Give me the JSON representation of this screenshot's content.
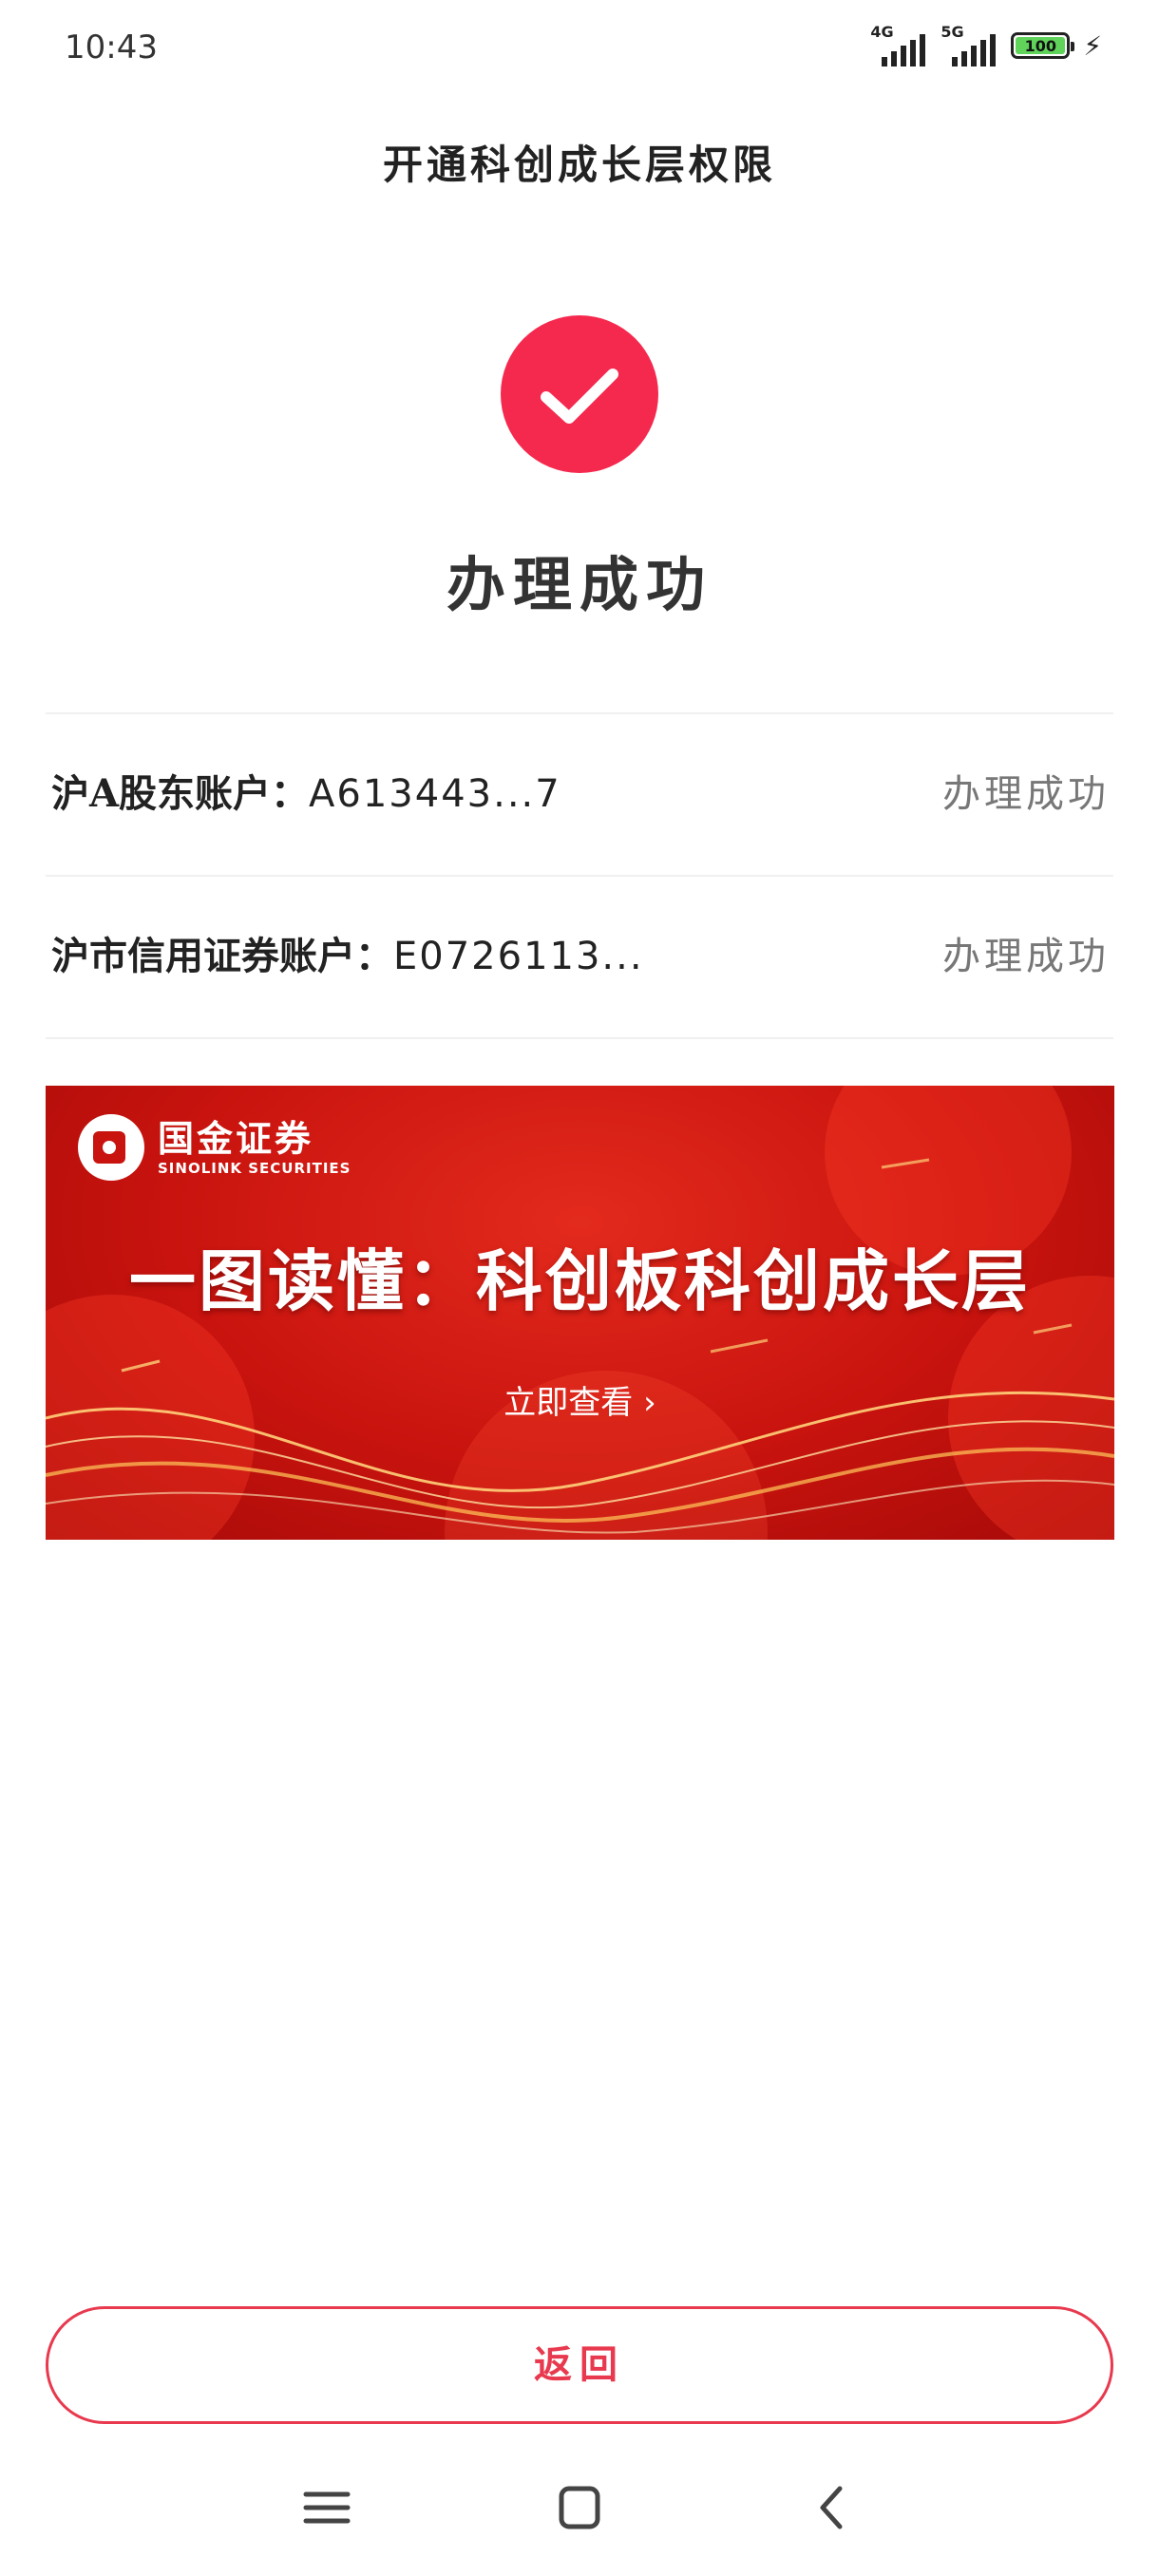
{
  "status_bar": {
    "time": "10:43",
    "network_1": "4G",
    "network_2": "5G",
    "battery": "100"
  },
  "header": {
    "title": "开通科创成长层权限"
  },
  "result": {
    "title": "办理成功"
  },
  "accounts": [
    {
      "label": "沪A股东账户：",
      "value": "A613443...7",
      "status": "办理成功"
    },
    {
      "label": "沪市信用证券账户：",
      "value": "E0726113...",
      "status": "办理成功"
    }
  ],
  "banner": {
    "brand_cn": "国金证券",
    "brand_en": "SINOLINK SECURITIES",
    "headline": "一图读懂：科创板科创成长层",
    "cta": "立即查看 ›"
  },
  "footer": {
    "return_label": "返回"
  },
  "colors": {
    "accent": "#f5284e",
    "button_border": "#e8394e",
    "banner_red": "#c8130e"
  }
}
